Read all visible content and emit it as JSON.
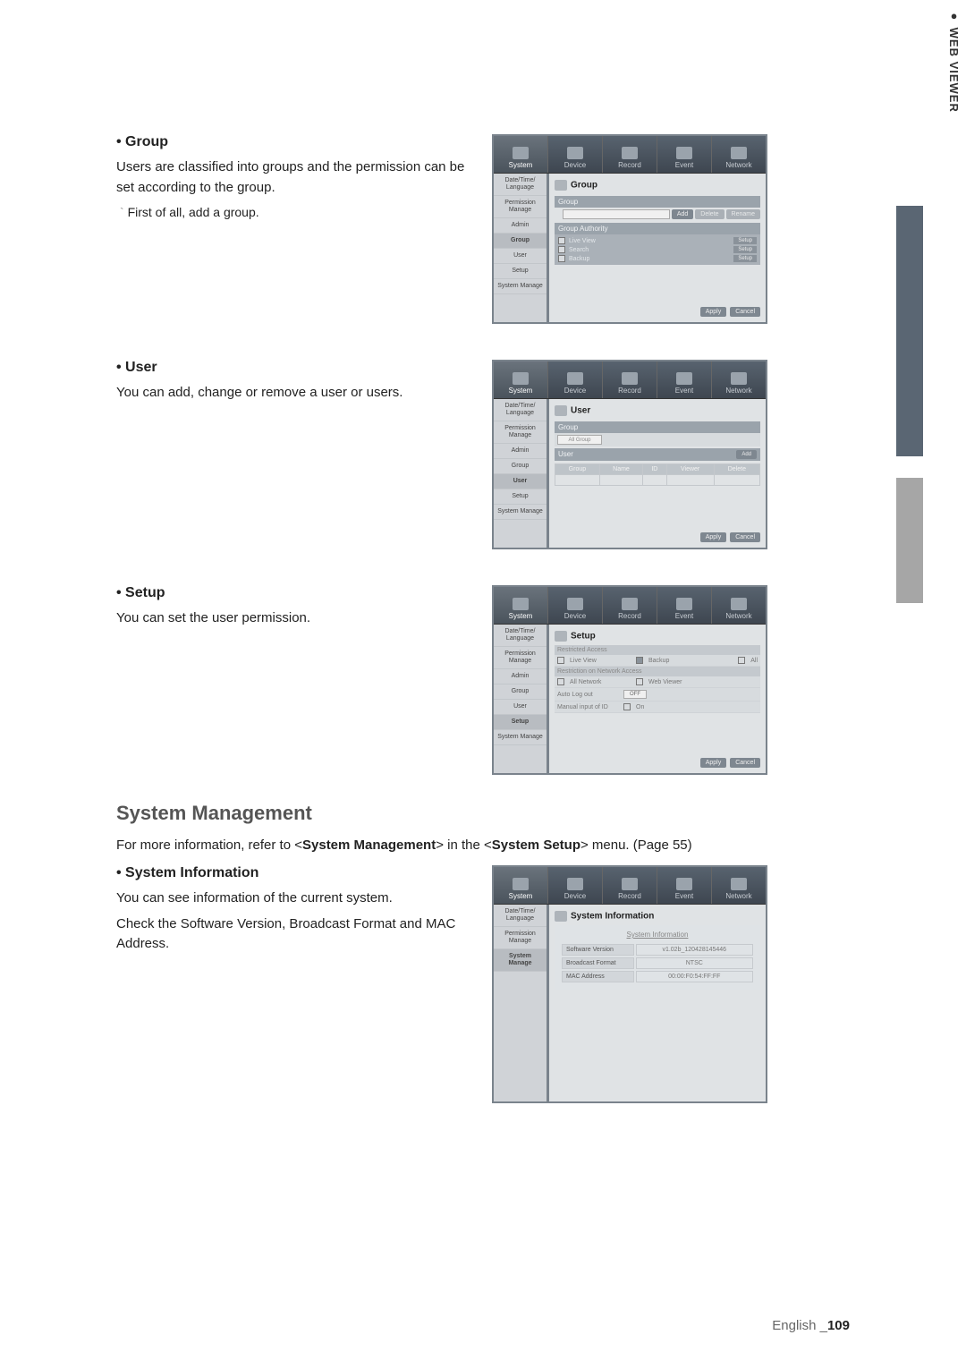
{
  "sideTab": "WEB VIEWER",
  "tabs": [
    "System",
    "Device",
    "Record",
    "Event",
    "Network"
  ],
  "sideMenu": {
    "dtl": "Date/Time/\nLanguage",
    "pm": "Permission\nManage",
    "admin": "Admin",
    "group": "Group",
    "user": "User",
    "setup": "Setup",
    "sm": "System\nManage"
  },
  "buttons": {
    "apply": "Apply",
    "cancel": "Cancel",
    "add": "Add",
    "delete": "Delete",
    "rename": "Rename",
    "setup": "Setup"
  },
  "group": {
    "heading": "• Group",
    "desc": "Users are classified into groups and the permission can be set according to the group.",
    "sub1": "First of all, add a group.",
    "panelTitle": "Group",
    "subHead1": "Group",
    "subHead2": "Group Authority",
    "auth": {
      "liveView": "Live View",
      "search": "Search",
      "backup": "Backup"
    }
  },
  "user": {
    "heading": "• User",
    "desc": "You can add, change or remove a user or users.",
    "panelTitle": "User",
    "groupLabel": "Group",
    "allGroup": "All Group",
    "userHead": "User",
    "cols": {
      "group": "Group",
      "name": "Name",
      "id": "ID",
      "viewer": "Viewer",
      "delete": "Delete"
    }
  },
  "setup": {
    "heading": "• Setup",
    "desc": "You can set the user permission.",
    "panelTitle": "Setup",
    "restrictedAccess": "Restricted Access",
    "liveView": "Live View",
    "backup": "Backup",
    "all": "All",
    "restrictionNet": "Restriction on Network Access",
    "allNetwork": "All Network",
    "webViewer": "Web Viewer",
    "autoLogout": "Auto Log out",
    "off": "OFF",
    "manualId": "Manual input of ID",
    "on": "On"
  },
  "sysMgmt": {
    "heading": "System Management",
    "ref1": "For more information, refer to <",
    "ref2": "System Management",
    "ref3": "> in the <",
    "ref4": "System Setup",
    "ref5": "> menu. (Page 55)",
    "siHeading": "• System Information",
    "siDesc1": "You can see information of the current system.",
    "siDesc2": "Check the Software Version, Broadcast Format and MAC Address.",
    "panelTitle": "System Information",
    "infoHead": "System Information",
    "sv": "Software Version",
    "svVal": "v1.02b_120428145446",
    "bf": "Broadcast Format",
    "bfVal": "NTSC",
    "mac": "MAC Address",
    "macVal": "00:00:F0:54:FF:FF"
  },
  "footer": {
    "lang": "English _",
    "page": "109"
  }
}
